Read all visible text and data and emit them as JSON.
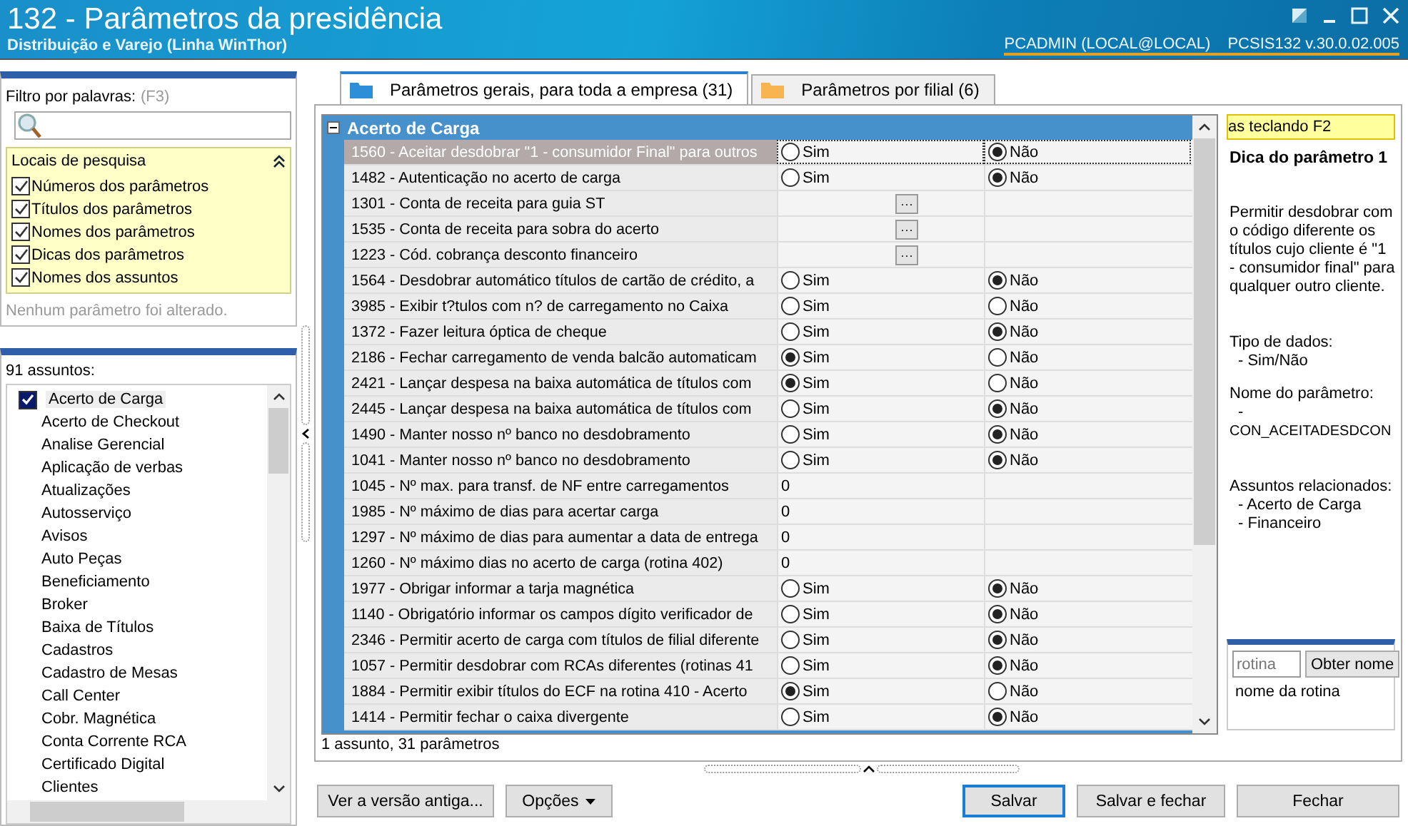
{
  "window": {
    "title": "132 - Parâmetros da presidência",
    "subtitle": "Distribuição e Varejo (Linha WinThor)",
    "user": "PCADMIN (LOCAL@LOCAL)",
    "version": "PCSIS132  v.30.0.02.005"
  },
  "filter": {
    "label": "Filtro por palavras:",
    "shortcut": "(F3)",
    "search_locations": {
      "title": "Locais de pesquisa",
      "expanded": true,
      "options": [
        {
          "label": "Números dos parâmetros",
          "checked": true
        },
        {
          "label": "Títulos dos parâmetros",
          "checked": true
        },
        {
          "label": "Nomes dos parâmetros",
          "checked": true
        },
        {
          "label": "Dicas dos parâmetros",
          "checked": true
        },
        {
          "label": "Nomes dos assuntos",
          "checked": true
        }
      ]
    },
    "status": "Nenhum parâmetro foi alterado."
  },
  "subjects": {
    "count_label": "91 assuntos:",
    "items": [
      {
        "label": "Acerto de Carga",
        "checked": true
      },
      {
        "label": "Acerto de Checkout",
        "checked": false
      },
      {
        "label": "Analise Gerencial",
        "checked": false
      },
      {
        "label": "Aplicação de verbas",
        "checked": false
      },
      {
        "label": "Atualizações",
        "checked": false
      },
      {
        "label": "Autosserviço",
        "checked": false
      },
      {
        "label": "Avisos",
        "checked": false
      },
      {
        "label": "Auto Peças",
        "checked": false
      },
      {
        "label": "Beneficiamento",
        "checked": false
      },
      {
        "label": "Broker",
        "checked": false
      },
      {
        "label": "Baixa de Títulos",
        "checked": false
      },
      {
        "label": "Cadastros",
        "checked": false
      },
      {
        "label": "Cadastro de Mesas",
        "checked": false
      },
      {
        "label": "Call Center",
        "checked": false
      },
      {
        "label": "Cobr. Magnética",
        "checked": false
      },
      {
        "label": "Conta Corrente RCA",
        "checked": false
      },
      {
        "label": "Certificado Digital",
        "checked": false
      },
      {
        "label": "Clientes",
        "checked": false
      }
    ]
  },
  "tabs": [
    {
      "label": "Parâmetros gerais, para toda a empresa  (31)",
      "selected": true
    },
    {
      "label": "Parâmetros por filial  (6)",
      "selected": false
    }
  ],
  "grid": {
    "group": "Acerto de Carga",
    "expanded": true,
    "rows": [
      {
        "label": "1560 - Aceitar desdobrar \"1 - consumidor Final\" para outros",
        "kind": "bool",
        "selected": true,
        "options": [
          {
            "label": "Sim",
            "selected": false
          },
          {
            "label": "Não",
            "selected": true
          }
        ]
      },
      {
        "label": "1482 - Autenticação no acerto de carga",
        "kind": "bool",
        "selected": false,
        "options": [
          {
            "label": "Sim",
            "selected": false
          },
          {
            "label": "Não",
            "selected": true
          }
        ]
      },
      {
        "label": "1301 - Conta de receita para guia ST",
        "kind": "lookup",
        "selected": false,
        "button": "···"
      },
      {
        "label": "1535 - Conta de receita para sobra do acerto",
        "kind": "lookup",
        "selected": false,
        "button": "···"
      },
      {
        "label": "1223 - Cód. cobrança desconto financeiro",
        "kind": "lookup",
        "selected": false,
        "button": "···"
      },
      {
        "label": "1564 - Desdobrar automático títulos de cartão de crédito, a",
        "kind": "bool",
        "selected": false,
        "options": [
          {
            "label": "Sim",
            "selected": false
          },
          {
            "label": "Não",
            "selected": true
          }
        ]
      },
      {
        "label": "3985 - Exibir t?tulos com n? de carregamento no Caixa",
        "kind": "bool",
        "selected": false,
        "options": [
          {
            "label": "Sim",
            "selected": false
          },
          {
            "label": "Não",
            "selected": false
          }
        ]
      },
      {
        "label": "1372 - Fazer leitura óptica de cheque",
        "kind": "bool",
        "selected": false,
        "options": [
          {
            "label": "Sim",
            "selected": false
          },
          {
            "label": "Não",
            "selected": true
          }
        ]
      },
      {
        "label": "2186 - Fechar carregamento de venda balcão automaticam",
        "kind": "bool",
        "selected": false,
        "options": [
          {
            "label": "Sim",
            "selected": true
          },
          {
            "label": "Não",
            "selected": false
          }
        ]
      },
      {
        "label": "2421 - Lançar despesa na baixa automática de títulos com",
        "kind": "bool",
        "selected": false,
        "options": [
          {
            "label": "Sim",
            "selected": true
          },
          {
            "label": "Não",
            "selected": false
          }
        ]
      },
      {
        "label": "2445 - Lançar despesa na baixa automática de títulos com",
        "kind": "bool",
        "selected": false,
        "options": [
          {
            "label": "Sim",
            "selected": false
          },
          {
            "label": "Não",
            "selected": true
          }
        ]
      },
      {
        "label": "1490 - Manter nosso nº banco no desdobramento",
        "kind": "bool",
        "selected": false,
        "options": [
          {
            "label": "Sim",
            "selected": false
          },
          {
            "label": "Não",
            "selected": true
          }
        ]
      },
      {
        "label": "1041 - Manter nosso nº banco no desdobramento",
        "kind": "bool",
        "selected": false,
        "options": [
          {
            "label": "Sim",
            "selected": false
          },
          {
            "label": "Não",
            "selected": true
          }
        ]
      },
      {
        "label": "1045 - Nº max. para transf. de NF entre carregamentos",
        "kind": "number",
        "selected": false,
        "value": "0"
      },
      {
        "label": "1985 - Nº máximo de dias para acertar carga",
        "kind": "number",
        "selected": false,
        "value": "0"
      },
      {
        "label": "1297 - Nº máximo de dias para aumentar a data de entrega",
        "kind": "number",
        "selected": false,
        "value": "0"
      },
      {
        "label": "1260 - Nº máximo dias no acerto de carga (rotina 402)",
        "kind": "number",
        "selected": false,
        "value": "0"
      },
      {
        "label": "1977 - Obrigar informar a tarja magnética",
        "kind": "bool",
        "selected": false,
        "options": [
          {
            "label": "Sim",
            "selected": false
          },
          {
            "label": "Não",
            "selected": true
          }
        ]
      },
      {
        "label": "1140 - Obrigatório informar os campos dígito verificador de",
        "kind": "bool",
        "selected": false,
        "options": [
          {
            "label": "Sim",
            "selected": false
          },
          {
            "label": "Não",
            "selected": true
          }
        ]
      },
      {
        "label": "2346 - Permitir acerto de carga com títulos de filial diferente",
        "kind": "bool",
        "selected": false,
        "options": [
          {
            "label": "Sim",
            "selected": false
          },
          {
            "label": "Não",
            "selected": true
          }
        ]
      },
      {
        "label": "1057 - Permitir desdobrar com RCAs diferentes (rotinas 41",
        "kind": "bool",
        "selected": false,
        "options": [
          {
            "label": "Sim",
            "selected": false
          },
          {
            "label": "Não",
            "selected": true
          }
        ]
      },
      {
        "label": "1884 - Permitir exibir títulos do ECF na rotina 410 - Acerto",
        "kind": "bool",
        "selected": false,
        "options": [
          {
            "label": "Sim",
            "selected": true
          },
          {
            "label": "Não",
            "selected": false
          }
        ]
      },
      {
        "label": "1414 - Permitir fechar o caixa divergente",
        "kind": "bool",
        "selected": false,
        "options": [
          {
            "label": "Sim",
            "selected": false
          },
          {
            "label": "Não",
            "selected": true
          }
        ]
      }
    ]
  },
  "hint": {
    "banner": "as teclando F2",
    "title": "Dica do parâmetro 1",
    "text": "Permitir desdobrar com o código diferente os títulos cujo cliente é \"1 - consumidor final\" para qualquer outro cliente.",
    "data_type_label": "Tipo de dados:",
    "data_type": "- Sim/Não",
    "name_label": "Nome do parâmetro:",
    "name_dash": "-",
    "name": "CON_ACEITADESDCON",
    "related_label": "Assuntos relacionados:",
    "related": [
      "- Acerto de Carga",
      "- Financeiro"
    ],
    "routine": {
      "placeholder": "rotina",
      "button": "Obter nome",
      "result": "nome da rotina"
    }
  },
  "status": "1 assunto, 31 parâmetros",
  "buttons": {
    "old_version": "Ver a versão antiga...",
    "options": "Opções",
    "save": "Salvar",
    "save_close": "Salvar e fechar",
    "close": "Fechar"
  }
}
